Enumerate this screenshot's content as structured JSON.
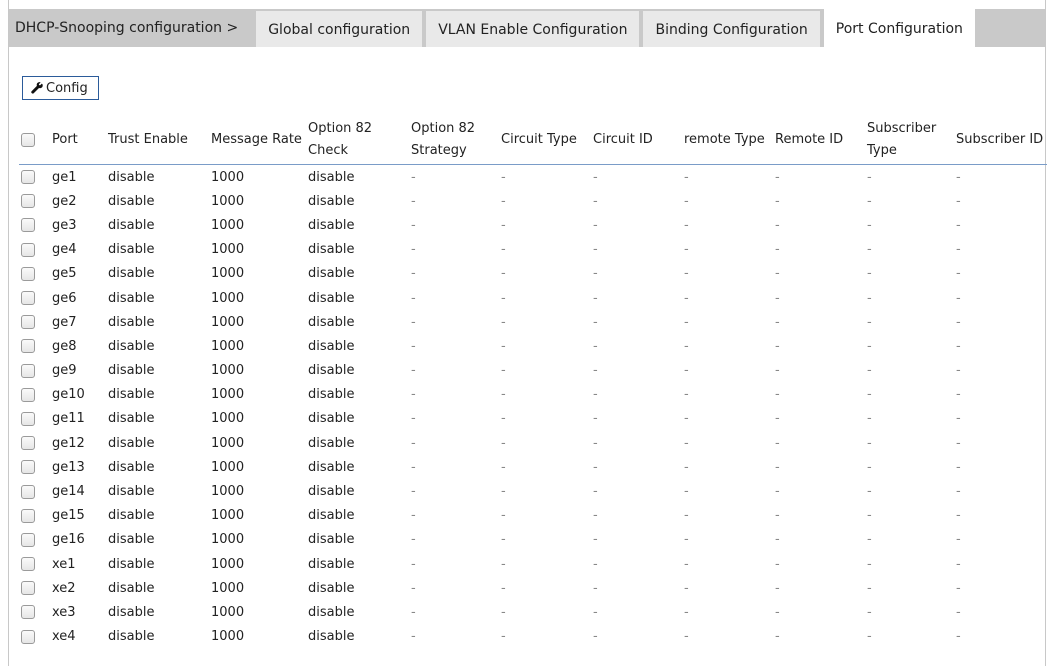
{
  "breadcrumb": "DHCP-Snooping configuration  >",
  "tabs": [
    {
      "label": "Global configuration"
    },
    {
      "label": "VLAN Enable Configuration"
    },
    {
      "label": "Binding Configuration"
    },
    {
      "label": "Port Configuration"
    }
  ],
  "config_button": "Config",
  "table": {
    "headers": [
      "Port",
      "Trust Enable",
      "Message Rate",
      "Option 82 Check",
      "Option 82 Strategy",
      "Circuit Type",
      "Circuit ID",
      "remote Type",
      "Remote ID",
      "Subscriber Type",
      "Subscriber ID"
    ],
    "rows": [
      [
        "ge1",
        "disable",
        "1000",
        "disable",
        "-",
        "-",
        "-",
        "-",
        "-",
        "-",
        "-"
      ],
      [
        "ge2",
        "disable",
        "1000",
        "disable",
        "-",
        "-",
        "-",
        "-",
        "-",
        "-",
        "-"
      ],
      [
        "ge3",
        "disable",
        "1000",
        "disable",
        "-",
        "-",
        "-",
        "-",
        "-",
        "-",
        "-"
      ],
      [
        "ge4",
        "disable",
        "1000",
        "disable",
        "-",
        "-",
        "-",
        "-",
        "-",
        "-",
        "-"
      ],
      [
        "ge5",
        "disable",
        "1000",
        "disable",
        "-",
        "-",
        "-",
        "-",
        "-",
        "-",
        "-"
      ],
      [
        "ge6",
        "disable",
        "1000",
        "disable",
        "-",
        "-",
        "-",
        "-",
        "-",
        "-",
        "-"
      ],
      [
        "ge7",
        "disable",
        "1000",
        "disable",
        "-",
        "-",
        "-",
        "-",
        "-",
        "-",
        "-"
      ],
      [
        "ge8",
        "disable",
        "1000",
        "disable",
        "-",
        "-",
        "-",
        "-",
        "-",
        "-",
        "-"
      ],
      [
        "ge9",
        "disable",
        "1000",
        "disable",
        "-",
        "-",
        "-",
        "-",
        "-",
        "-",
        "-"
      ],
      [
        "ge10",
        "disable",
        "1000",
        "disable",
        "-",
        "-",
        "-",
        "-",
        "-",
        "-",
        "-"
      ],
      [
        "ge11",
        "disable",
        "1000",
        "disable",
        "-",
        "-",
        "-",
        "-",
        "-",
        "-",
        "-"
      ],
      [
        "ge12",
        "disable",
        "1000",
        "disable",
        "-",
        "-",
        "-",
        "-",
        "-",
        "-",
        "-"
      ],
      [
        "ge13",
        "disable",
        "1000",
        "disable",
        "-",
        "-",
        "-",
        "-",
        "-",
        "-",
        "-"
      ],
      [
        "ge14",
        "disable",
        "1000",
        "disable",
        "-",
        "-",
        "-",
        "-",
        "-",
        "-",
        "-"
      ],
      [
        "ge15",
        "disable",
        "1000",
        "disable",
        "-",
        "-",
        "-",
        "-",
        "-",
        "-",
        "-"
      ],
      [
        "ge16",
        "disable",
        "1000",
        "disable",
        "-",
        "-",
        "-",
        "-",
        "-",
        "-",
        "-"
      ],
      [
        "xe1",
        "disable",
        "1000",
        "disable",
        "-",
        "-",
        "-",
        "-",
        "-",
        "-",
        "-"
      ],
      [
        "xe2",
        "disable",
        "1000",
        "disable",
        "-",
        "-",
        "-",
        "-",
        "-",
        "-",
        "-"
      ],
      [
        "xe3",
        "disable",
        "1000",
        "disable",
        "-",
        "-",
        "-",
        "-",
        "-",
        "-",
        "-"
      ],
      [
        "xe4",
        "disable",
        "1000",
        "disable",
        "-",
        "-",
        "-",
        "-",
        "-",
        "-",
        "-"
      ]
    ]
  }
}
